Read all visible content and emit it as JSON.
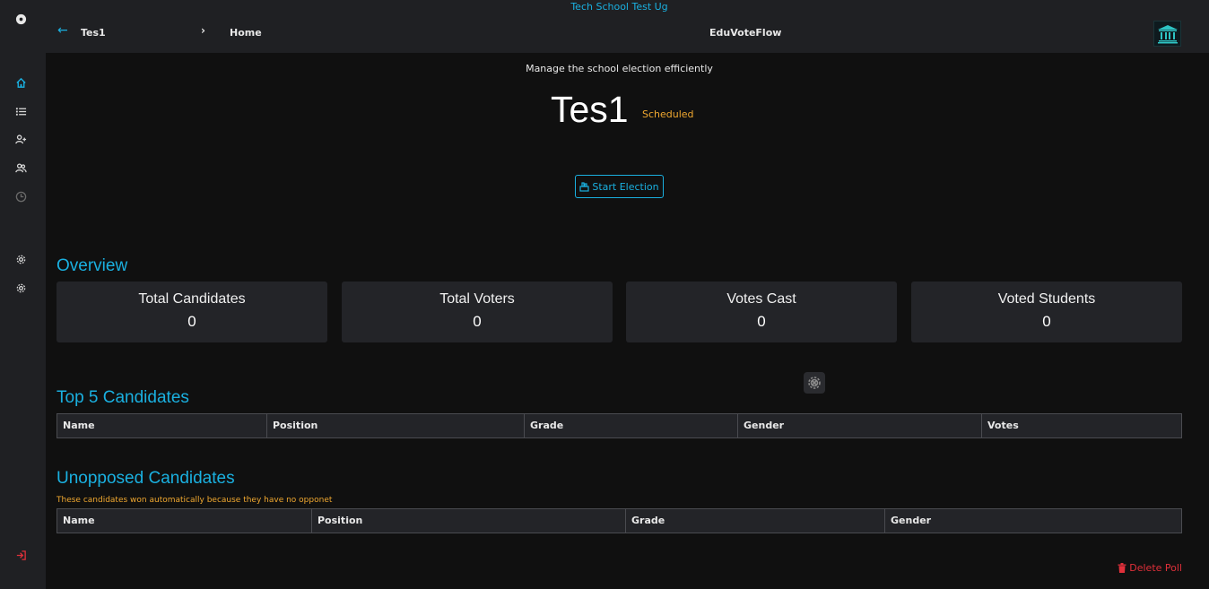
{
  "header": {
    "school_name": "Tech School Test Ug",
    "breadcrumb_poll": "Tes1",
    "breadcrumb_home": "Home",
    "app_title": "EduVoteFlow"
  },
  "sidebar": {
    "items": [
      {
        "icon": "home-icon",
        "active": true
      },
      {
        "icon": "list-icon"
      },
      {
        "icon": "add-user-icon"
      },
      {
        "icon": "users-icon"
      },
      {
        "icon": "clock-icon",
        "disabled": true
      },
      {
        "icon": "gear-icon"
      },
      {
        "icon": "gear-icon"
      },
      {
        "icon": "logout-icon"
      }
    ]
  },
  "poll": {
    "subtitle": "Manage the school election efficiently",
    "name": "Tes1",
    "status": "Scheduled",
    "start_label": "Start Election"
  },
  "overview": {
    "title": "Overview",
    "cards": [
      {
        "label": "Total Candidates",
        "value": "0"
      },
      {
        "label": "Total Voters",
        "value": "0"
      },
      {
        "label": "Votes Cast",
        "value": "0"
      },
      {
        "label": "Voted Students",
        "value": "0"
      }
    ]
  },
  "top_candidates": {
    "title": "Top 5 Candidates",
    "columns": [
      "Name",
      "Position",
      "Grade",
      "Gender",
      "Votes"
    ]
  },
  "unopposed": {
    "title": "Unopposed Candidates",
    "note": "These candidates won automatically because they have no opponet",
    "columns": [
      "Name",
      "Position",
      "Grade",
      "Gender"
    ]
  },
  "actions": {
    "delete_label": "Delete Poll"
  },
  "colors": {
    "accent": "#1ab0e0",
    "status": "#f0a830",
    "danger": "#e0303a",
    "card_bg": "#232428",
    "sidebar_bg": "#1f2023"
  }
}
